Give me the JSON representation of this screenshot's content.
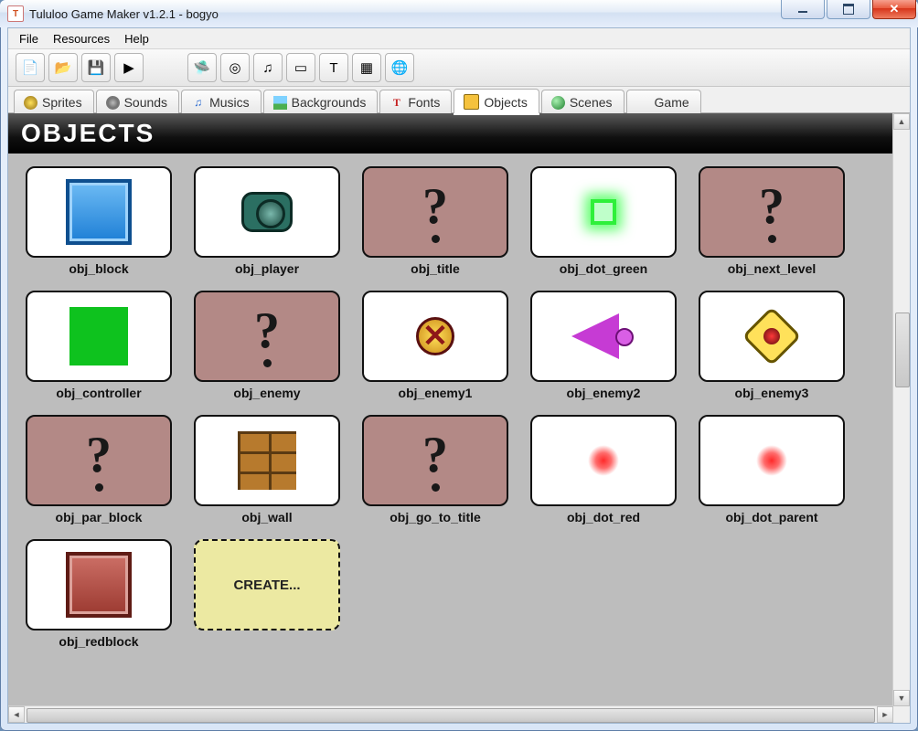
{
  "window": {
    "title": "Tululoo Game Maker v1.2.1 - bogyo"
  },
  "menubar": {
    "items": [
      "File",
      "Resources",
      "Help"
    ]
  },
  "toolbar": {
    "buttons": [
      {
        "name": "new-button",
        "glyph": "📄"
      },
      {
        "name": "open-button",
        "glyph": "📂"
      },
      {
        "name": "save-button",
        "glyph": "💾"
      },
      {
        "name": "run-button",
        "glyph": "▶"
      }
    ],
    "resource_buttons": [
      {
        "name": "add-sprite-button",
        "glyph": "🛸"
      },
      {
        "name": "add-sound-button",
        "glyph": "◎"
      },
      {
        "name": "add-music-button",
        "glyph": "♫"
      },
      {
        "name": "add-background-button",
        "glyph": "▭"
      },
      {
        "name": "add-font-button",
        "glyph": "T"
      },
      {
        "name": "add-object-button",
        "glyph": "▦"
      },
      {
        "name": "add-scene-button",
        "glyph": "🌐"
      }
    ]
  },
  "tabs": {
    "items": [
      {
        "name": "tab-sprites",
        "label": "Sprites",
        "icon": "ti-sprite"
      },
      {
        "name": "tab-sounds",
        "label": "Sounds",
        "icon": "ti-sound"
      },
      {
        "name": "tab-musics",
        "label": "Musics",
        "icon": "ti-music",
        "glyph": "♫"
      },
      {
        "name": "tab-backgrounds",
        "label": "Backgrounds",
        "icon": "ti-bg"
      },
      {
        "name": "tab-fonts",
        "label": "Fonts",
        "icon": "ti-font",
        "glyph": "T"
      },
      {
        "name": "tab-objects",
        "label": "Objects",
        "icon": "ti-object",
        "active": true
      },
      {
        "name": "tab-scenes",
        "label": "Scenes",
        "icon": "ti-scene"
      },
      {
        "name": "tab-game",
        "label": "Game",
        "icon": ""
      }
    ]
  },
  "panel": {
    "title": "OBJECTS"
  },
  "objects": [
    {
      "name": "obj_block",
      "sprite": "spr-block"
    },
    {
      "name": "obj_player",
      "sprite": "spr-player"
    },
    {
      "name": "obj_title",
      "sprite": null
    },
    {
      "name": "obj_dot_green",
      "sprite": "spr-dot-green"
    },
    {
      "name": "obj_next_level",
      "sprite": null
    },
    {
      "name": "obj_controller",
      "sprite": "spr-controller"
    },
    {
      "name": "obj_enemy",
      "sprite": null
    },
    {
      "name": "obj_enemy1",
      "sprite": "spr-enemy1"
    },
    {
      "name": "obj_enemy2",
      "sprite": "spr-enemy2"
    },
    {
      "name": "obj_enemy3",
      "sprite": "spr-enemy3"
    },
    {
      "name": "obj_par_block",
      "sprite": null
    },
    {
      "name": "obj_wall",
      "sprite": "spr-wall"
    },
    {
      "name": "obj_go_to_title",
      "sprite": null
    },
    {
      "name": "obj_dot_red",
      "sprite": "spr-dot-red"
    },
    {
      "name": "obj_dot_parent",
      "sprite": "spr-dot-red"
    },
    {
      "name": "obj_redblock",
      "sprite": "spr-redblock"
    }
  ],
  "create_button": {
    "label": "CREATE..."
  }
}
